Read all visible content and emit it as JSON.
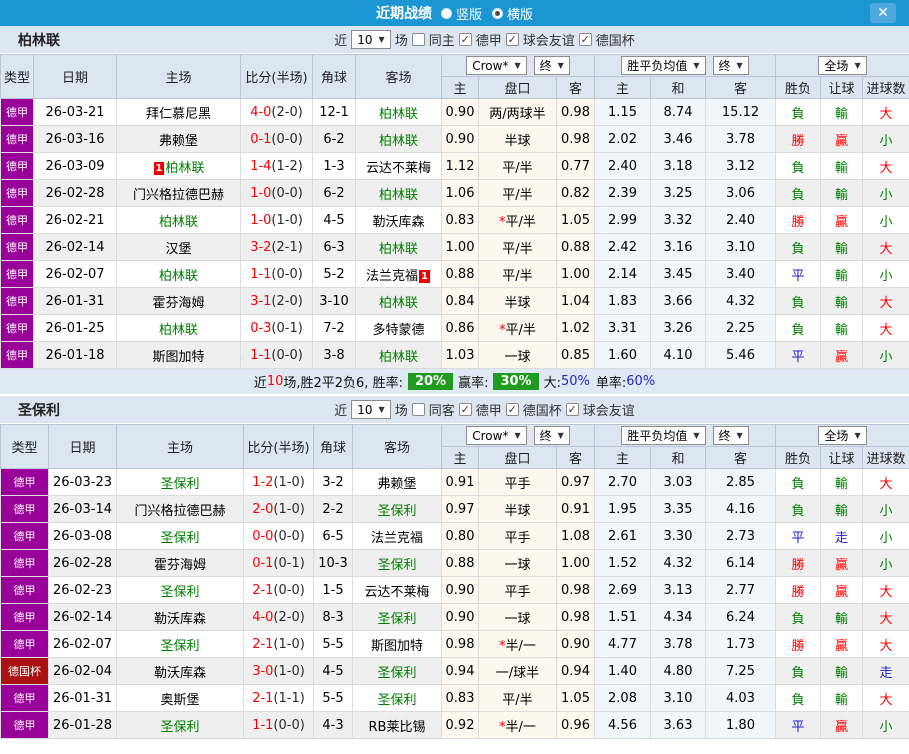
{
  "titlebar": {
    "title": "近期战绩",
    "close_glyph": "✕",
    "view_options": [
      {
        "label": "竖版",
        "selected": false
      },
      {
        "label": "横版",
        "selected": true
      }
    ]
  },
  "columns": {
    "left": [
      "类型",
      "日期",
      "主场",
      "比分(半场)",
      "角球",
      "客场"
    ],
    "asian_sub": [
      "主",
      "盘口",
      "客"
    ],
    "euro_sub": [
      "主",
      "和",
      "客"
    ],
    "result_sub": [
      "胜负",
      "让球",
      "进球数"
    ]
  },
  "type_colors": {
    "德甲": "#990099",
    "德国杯": "#aa1111"
  },
  "glyph_colors": {
    "勝": "#ff0000",
    "贏": "#ff0000",
    "大": "#ff0000",
    "負": "#008000",
    "輸": "#008000",
    "小": "#008000",
    "平": "#1c1ccd",
    "走": "#1c1ccd"
  },
  "sections": [
    {
      "team": "柏林联",
      "filter": {
        "near": "近",
        "count": "10",
        "games": "场",
        "same": {
          "label": "同主",
          "checked": false
        },
        "leagues": [
          {
            "label": "德甲",
            "checked": true
          },
          {
            "label": "球会友谊",
            "checked": true
          },
          {
            "label": "德国杯",
            "checked": true
          }
        ]
      },
      "selects": {
        "company": "Crow*",
        "company_period": "终",
        "euro": "胜平负均值",
        "euro_period": "终",
        "scope": "全场"
      },
      "rows": [
        {
          "type": "德甲",
          "date": "26-03-21",
          "home": {
            "name": "拜仁慕尼黑"
          },
          "ft": "4-0",
          "ht": "(2-0)",
          "corner": "12-1",
          "away": {
            "name": "柏林联",
            "focus": true
          },
          "ah": "0.90",
          "line": "两/两球半",
          "aa": "0.98",
          "eh": "1.15",
          "ed": "8.74",
          "ea": "15.12",
          "res": "負",
          "let": "輸",
          "goal": "大"
        },
        {
          "type": "德甲",
          "date": "26-03-16",
          "home": {
            "name": "弗赖堡"
          },
          "ft": "0-1",
          "ht": "(0-0)",
          "corner": "6-2",
          "away": {
            "name": "柏林联",
            "focus": true
          },
          "ah": "0.90",
          "line": "半球",
          "aa": "0.98",
          "eh": "2.02",
          "ed": "3.46",
          "ea": "3.78",
          "res": "勝",
          "let": "贏",
          "goal": "小"
        },
        {
          "type": "德甲",
          "date": "26-03-09",
          "home": {
            "name": "柏林联",
            "focus": true,
            "badge": "1",
            "badge_pos": "before"
          },
          "ft": "1-4",
          "ht": "(1-2)",
          "corner": "1-3",
          "away": {
            "name": "云达不莱梅"
          },
          "ah": "1.12",
          "line": "平/半",
          "aa": "0.77",
          "eh": "2.40",
          "ed": "3.18",
          "ea": "3.12",
          "res": "負",
          "let": "輸",
          "goal": "大"
        },
        {
          "type": "德甲",
          "date": "26-02-28",
          "home": {
            "name": "门兴格拉德巴赫"
          },
          "ft": "1-0",
          "ht": "(0-0)",
          "corner": "6-2",
          "away": {
            "name": "柏林联",
            "focus": true
          },
          "ah": "1.06",
          "line": "平/半",
          "aa": "0.82",
          "eh": "2.39",
          "ed": "3.25",
          "ea": "3.06",
          "res": "負",
          "let": "輸",
          "goal": "小"
        },
        {
          "type": "德甲",
          "date": "26-02-21",
          "home": {
            "name": "柏林联",
            "focus": true
          },
          "ft": "1-0",
          "ht": "(1-0)",
          "corner": "4-5",
          "away": {
            "name": "勒沃库森"
          },
          "ah": "0.83",
          "line": "平/半",
          "star": true,
          "aa": "1.05",
          "eh": "2.99",
          "ed": "3.32",
          "ea": "2.40",
          "res": "勝",
          "let": "贏",
          "goal": "小"
        },
        {
          "type": "德甲",
          "date": "26-02-14",
          "home": {
            "name": "汉堡"
          },
          "ft": "3-2",
          "ht": "(2-1)",
          "corner": "6-3",
          "away": {
            "name": "柏林联",
            "focus": true
          },
          "ah": "1.00",
          "line": "平/半",
          "aa": "0.88",
          "eh": "2.42",
          "ed": "3.16",
          "ea": "3.10",
          "res": "負",
          "let": "輸",
          "goal": "大"
        },
        {
          "type": "德甲",
          "date": "26-02-07",
          "home": {
            "name": "柏林联",
            "focus": true
          },
          "ft": "1-1",
          "ht": "(0-0)",
          "corner": "5-2",
          "away": {
            "name": "法兰克福",
            "badge": "1",
            "badge_pos": "after"
          },
          "ah": "0.88",
          "line": "平/半",
          "aa": "1.00",
          "eh": "2.14",
          "ed": "3.45",
          "ea": "3.40",
          "res": "平",
          "let": "輸",
          "goal": "小"
        },
        {
          "type": "德甲",
          "date": "26-01-31",
          "home": {
            "name": "霍芬海姆"
          },
          "ft": "3-1",
          "ht": "(2-0)",
          "corner": "3-10",
          "away": {
            "name": "柏林联",
            "focus": true
          },
          "ah": "0.84",
          "line": "半球",
          "aa": "1.04",
          "eh": "1.83",
          "ed": "3.66",
          "ea": "4.32",
          "res": "負",
          "let": "輸",
          "goal": "大"
        },
        {
          "type": "德甲",
          "date": "26-01-25",
          "home": {
            "name": "柏林联",
            "focus": true
          },
          "ft": "0-3",
          "ht": "(0-1)",
          "corner": "7-2",
          "away": {
            "name": "多特蒙德"
          },
          "ah": "0.86",
          "line": "平/半",
          "star": true,
          "aa": "1.02",
          "eh": "3.31",
          "ed": "3.26",
          "ea": "2.25",
          "res": "負",
          "let": "輸",
          "goal": "大"
        },
        {
          "type": "德甲",
          "date": "26-01-18",
          "home": {
            "name": "斯图加特"
          },
          "ft": "1-1",
          "ht": "(0-0)",
          "corner": "3-8",
          "away": {
            "name": "柏林联",
            "focus": true
          },
          "ah": "1.03",
          "line": "一球",
          "aa": "0.85",
          "eh": "1.60",
          "ed": "4.10",
          "ea": "5.46",
          "res": "平",
          "let": "贏",
          "goal": "小"
        }
      ],
      "summary": {
        "near": "近",
        "count": "10",
        "stats": "场,胜2平2负6, 胜率:",
        "rate1": "20%",
        "label2": "赢率:",
        "rate2": "30%",
        "label3": "大:",
        "rate3": "50%",
        "label4": "单率:",
        "rate4": "60%"
      }
    },
    {
      "team": "圣保利",
      "filter": {
        "near": "近",
        "count": "10",
        "games": "场",
        "same": {
          "label": "同客",
          "checked": false
        },
        "leagues": [
          {
            "label": "德甲",
            "checked": true
          },
          {
            "label": "德国杯",
            "checked": true
          },
          {
            "label": "球会友谊",
            "checked": true
          }
        ]
      },
      "selects": {
        "company": "Crow*",
        "company_period": "终",
        "euro": "胜平负均值",
        "euro_period": "终",
        "scope": "全场"
      },
      "rows": [
        {
          "type": "德甲",
          "date": "26-03-23",
          "home": {
            "name": "圣保利",
            "focus": true
          },
          "ft": "1-2",
          "ht": "(1-0)",
          "corner": "3-2",
          "away": {
            "name": "弗赖堡"
          },
          "ah": "0.91",
          "line": "平手",
          "aa": "0.97",
          "eh": "2.70",
          "ed": "3.03",
          "ea": "2.85",
          "res": "負",
          "let": "輸",
          "goal": "大"
        },
        {
          "type": "德甲",
          "date": "26-03-14",
          "home": {
            "name": "门兴格拉德巴赫"
          },
          "ft": "2-0",
          "ht": "(1-0)",
          "corner": "2-2",
          "away": {
            "name": "圣保利",
            "focus": true
          },
          "ah": "0.97",
          "line": "半球",
          "aa": "0.91",
          "eh": "1.95",
          "ed": "3.35",
          "ea": "4.16",
          "res": "負",
          "let": "輸",
          "goal": "小"
        },
        {
          "type": "德甲",
          "date": "26-03-08",
          "home": {
            "name": "圣保利",
            "focus": true
          },
          "ft": "0-0",
          "ht": "(0-0)",
          "corner": "6-5",
          "away": {
            "name": "法兰克福"
          },
          "ah": "0.80",
          "line": "平手",
          "aa": "1.08",
          "eh": "2.61",
          "ed": "3.30",
          "ea": "2.73",
          "res": "平",
          "let": "走",
          "goal": "小"
        },
        {
          "type": "德甲",
          "date": "26-02-28",
          "home": {
            "name": "霍芬海姆"
          },
          "ft": "0-1",
          "ht": "(0-1)",
          "corner": "10-3",
          "away": {
            "name": "圣保利",
            "focus": true
          },
          "ah": "0.88",
          "line": "一球",
          "aa": "1.00",
          "eh": "1.52",
          "ed": "4.32",
          "ea": "6.14",
          "res": "勝",
          "let": "贏",
          "goal": "小"
        },
        {
          "type": "德甲",
          "date": "26-02-23",
          "home": {
            "name": "圣保利",
            "focus": true
          },
          "ft": "2-1",
          "ht": "(0-0)",
          "corner": "1-5",
          "away": {
            "name": "云达不莱梅"
          },
          "ah": "0.90",
          "line": "平手",
          "aa": "0.98",
          "eh": "2.69",
          "ed": "3.13",
          "ea": "2.77",
          "res": "勝",
          "let": "贏",
          "goal": "大"
        },
        {
          "type": "德甲",
          "date": "26-02-14",
          "home": {
            "name": "勒沃库森"
          },
          "ft": "4-0",
          "ht": "(2-0)",
          "corner": "8-3",
          "away": {
            "name": "圣保利",
            "focus": true
          },
          "ah": "0.90",
          "line": "一球",
          "aa": "0.98",
          "eh": "1.51",
          "ed": "4.34",
          "ea": "6.24",
          "res": "負",
          "let": "輸",
          "goal": "大"
        },
        {
          "type": "德甲",
          "date": "26-02-07",
          "home": {
            "name": "圣保利",
            "focus": true
          },
          "ft": "2-1",
          "ht": "(1-0)",
          "corner": "5-5",
          "away": {
            "name": "斯图加特"
          },
          "ah": "0.98",
          "line": "半/一",
          "star": true,
          "aa": "0.90",
          "eh": "4.77",
          "ed": "3.78",
          "ea": "1.73",
          "res": "勝",
          "let": "贏",
          "goal": "大"
        },
        {
          "type": "德国杯",
          "date": "26-02-04",
          "home": {
            "name": "勒沃库森"
          },
          "ft": "3-0",
          "ht": "(1-0)",
          "corner": "4-5",
          "away": {
            "name": "圣保利",
            "focus": true
          },
          "ah": "0.94",
          "line": "一/球半",
          "aa": "0.94",
          "eh": "1.40",
          "ed": "4.80",
          "ea": "7.25",
          "res": "負",
          "let": "輸",
          "goal": "走"
        },
        {
          "type": "德甲",
          "date": "26-01-31",
          "home": {
            "name": "奥斯堡"
          },
          "ft": "2-1",
          "ht": "(1-1)",
          "corner": "5-5",
          "away": {
            "name": "圣保利",
            "focus": true
          },
          "ah": "0.83",
          "line": "平/半",
          "aa": "1.05",
          "eh": "2.08",
          "ed": "3.10",
          "ea": "4.03",
          "res": "負",
          "let": "輸",
          "goal": "大"
        },
        {
          "type": "德甲",
          "date": "26-01-28",
          "home": {
            "name": "圣保利",
            "focus": true
          },
          "ft": "1-1",
          "ht": "(0-0)",
          "corner": "4-3",
          "away": {
            "name": "RB莱比锡"
          },
          "ah": "0.92",
          "line": "半/一",
          "star": true,
          "aa": "0.96",
          "eh": "4.56",
          "ed": "3.63",
          "ea": "1.80",
          "res": "平",
          "let": "贏",
          "goal": "小"
        }
      ],
      "summary": null
    }
  ]
}
